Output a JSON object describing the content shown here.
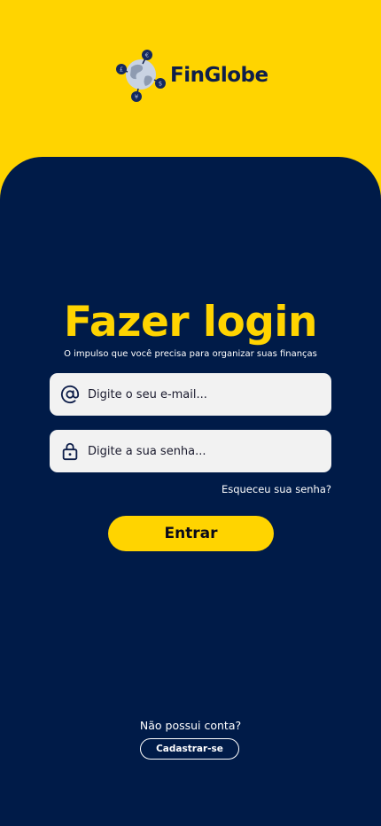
{
  "brand": {
    "name": "FinGlobe",
    "logo_icon": "globe-currency-icon"
  },
  "login": {
    "title": "Fazer login",
    "subtitle": "O impulso que você precisa para organizar suas finanças",
    "email_placeholder": "Digite o seu e-mail...",
    "password_placeholder": "Digite a sua senha...",
    "email_icon": "at-sign-icon",
    "password_icon": "lock-icon",
    "forgot_link": "Esqueceu sua senha?",
    "submit_label": "Entrar"
  },
  "signup": {
    "prompt": "Não possui conta?",
    "button_label": "Cadastrar-se"
  },
  "colors": {
    "accent": "#FFD400",
    "panel": "#001B48",
    "field": "#F2F2F2"
  }
}
